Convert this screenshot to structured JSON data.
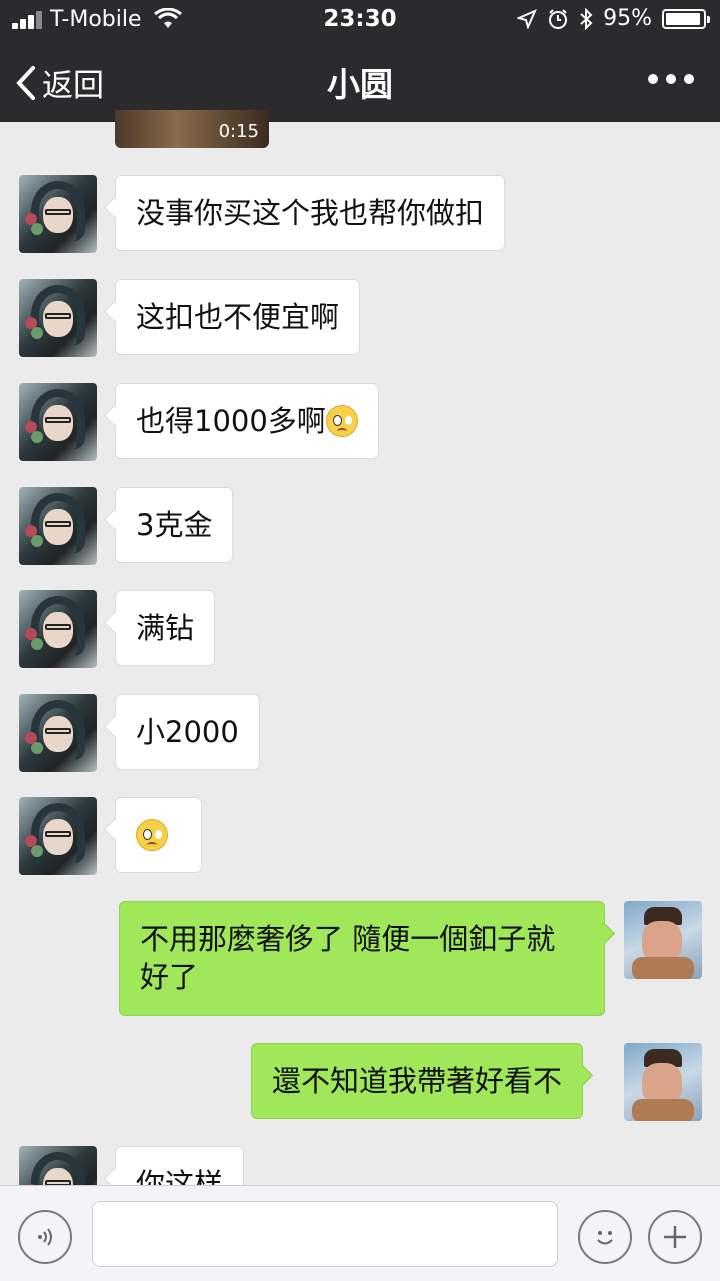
{
  "status": {
    "carrier": "T-Mobile",
    "time": "23:30",
    "battery": "95%",
    "battery_level": 0.95
  },
  "nav": {
    "back_label": "返回",
    "title": "小圆"
  },
  "video": {
    "duration": "0:15"
  },
  "messages": [
    {
      "side": "in",
      "text": "没事你买这个我也帮你做扣"
    },
    {
      "side": "in",
      "text": "这扣也不便宜啊"
    },
    {
      "side": "in",
      "text": "也得1000多啊",
      "emoji": "pleading-face-icon"
    },
    {
      "side": "in",
      "text": "3克金"
    },
    {
      "side": "in",
      "text": "满钻"
    },
    {
      "side": "in",
      "text": "小2000"
    },
    {
      "side": "in",
      "text": "",
      "emoji": "pleading-face-icon"
    },
    {
      "side": "out",
      "text": "不用那麼奢侈了 隨便一個釦子就好了"
    },
    {
      "side": "out",
      "text": "還不知道我帶著好看不"
    },
    {
      "side": "in",
      "text": "你这样"
    }
  ],
  "colors": {
    "topbar": "#2b2b2e",
    "chat_bg": "#ebebeb",
    "outgoing_bubble": "#a0e75a",
    "incoming_bubble": "#ffffff"
  }
}
